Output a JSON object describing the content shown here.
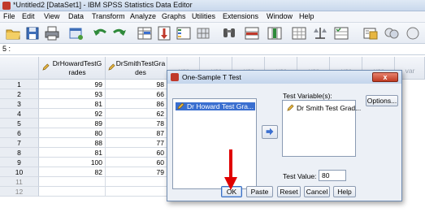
{
  "window": {
    "title": "*Untitled2 [DataSet1] - IBM SPSS Statistics Data Editor"
  },
  "menu": [
    "File",
    "Edit",
    "View",
    "Data",
    "Transform",
    "Analyze",
    "Graphs",
    "Utilities",
    "Extensions",
    "Window",
    "Help"
  ],
  "cellref": {
    "text": "5 :"
  },
  "grid": {
    "columns": [
      "DrHowardTestGrades",
      "DrSmithTestGrades"
    ],
    "column_line1": [
      "DrHowardTestG",
      "DrSmithTestGra"
    ],
    "column_line2": [
      "rades",
      "des"
    ],
    "var_label": "var",
    "rows": [
      {
        "n": "1",
        "a": "99",
        "b": "98"
      },
      {
        "n": "2",
        "a": "93",
        "b": "66"
      },
      {
        "n": "3",
        "a": "81",
        "b": "86"
      },
      {
        "n": "4",
        "a": "92",
        "b": "62"
      },
      {
        "n": "5",
        "a": "89",
        "b": "78"
      },
      {
        "n": "6",
        "a": "80",
        "b": "87"
      },
      {
        "n": "7",
        "a": "88",
        "b": "77"
      },
      {
        "n": "8",
        "a": "81",
        "b": "60"
      },
      {
        "n": "9",
        "a": "100",
        "b": "60"
      },
      {
        "n": "10",
        "a": "82",
        "b": "79"
      },
      {
        "n": "11",
        "a": "",
        "b": ""
      },
      {
        "n": "12",
        "a": "",
        "b": ""
      }
    ]
  },
  "dialog": {
    "title": "One-Sample T Test",
    "close_label": "x",
    "source_item": "Dr Howard Test Gra...",
    "test_variables_label": "Test Variable(s):",
    "test_variable_item": "Dr Smith Test Grad...",
    "options_label": "Options...",
    "test_value_label": "Test Value:",
    "test_value": "80",
    "buttons": {
      "ok": "OK",
      "paste": "Paste",
      "reset": "Reset",
      "cancel": "Cancel",
      "help": "Help"
    }
  },
  "colors": {
    "selection": "#3a6fd0",
    "arrow": "#e00000",
    "accent": "#3b6fc2"
  }
}
